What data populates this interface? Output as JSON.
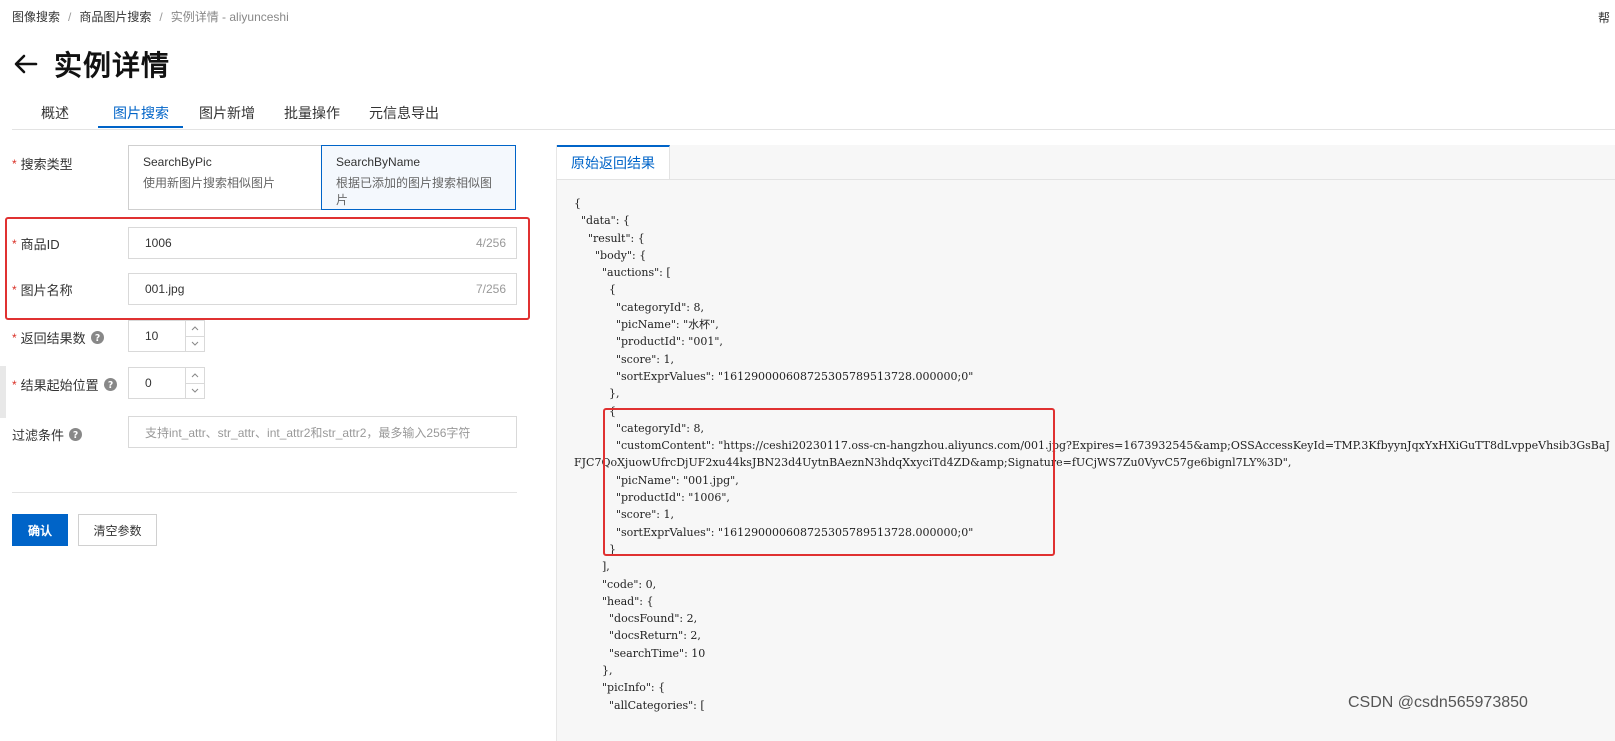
{
  "breadcrumb": {
    "item1": "图像搜索",
    "item2": "商品图片搜索",
    "item3": "实例详情 - aliyunceshi",
    "separator": "/"
  },
  "corner_text": "帮",
  "page": {
    "title": "实例详情"
  },
  "tabs": [
    {
      "label": "概述"
    },
    {
      "label": "图片搜索"
    },
    {
      "label": "图片新增"
    },
    {
      "label": "批量操作"
    },
    {
      "label": "元信息导出"
    }
  ],
  "active_tab": "图片搜索",
  "form": {
    "required_mark": "*",
    "search_type": {
      "label": "搜索类型",
      "options": [
        {
          "title": "SearchByPic",
          "desc": "使用新图片搜索相似图片"
        },
        {
          "title": "SearchByName",
          "desc": "根据已添加的图片搜索相似图片"
        }
      ],
      "selected": "SearchByName"
    },
    "product_id": {
      "label": "商品ID",
      "value": "1006",
      "count": "4/256"
    },
    "pic_name": {
      "label": "图片名称",
      "value": "001.jpg",
      "count": "7/256"
    },
    "num": {
      "label": "返回结果数",
      "value": "10"
    },
    "start": {
      "label": "结果起始位置",
      "value": "0"
    },
    "filter": {
      "label": "过滤条件",
      "placeholder": "支持int_attr、str_attr、int_attr2和str_attr2，最多输入256字符"
    },
    "confirm_label": "确认",
    "clear_label": "清空参数"
  },
  "result_panel": {
    "tab_label": "原始返回结果",
    "json_lines": [
      "{",
      "  \"data\": {",
      "    \"result\": {",
      "      \"body\": {",
      "        \"auctions\": [",
      "          {",
      "            \"categoryId\": 8,",
      "            \"picName\": \"水杯\",",
      "            \"productId\": \"001\",",
      "            \"score\": 1,",
      "            \"sortExprValues\": \"161290000608725305789513728.000000;0\"",
      "          },",
      "          {",
      "            \"categoryId\": 8,",
      "            \"customContent\": \"https://ceshi20230117.oss-cn-hangzhou.aliyuncs.com/001.jpg?Expires=1673932545&amp;OSSAccessKeyId=TMP.3KfbyynJqxYxHXiGuTT8dLvppeVhsib3GsBaJ",
      "FJC7QoXjuowUfrcDjUF2xu44ksJBN23d4UytnBAeznN3hdqXxyciTd4ZD&amp;Signature=fUCjWS7Zu0VyvC57ge6bignl7LY%3D\",",
      "            \"picName\": \"001.jpg\",",
      "            \"productId\": \"1006\",",
      "            \"score\": 1,",
      "            \"sortExprValues\": \"161290000608725305789513728.000000;0\"",
      "          }",
      "        ],",
      "        \"code\": 0,",
      "        \"head\": {",
      "          \"docsFound\": 2,",
      "          \"docsReturn\": 2,",
      "          \"searchTime\": 10",
      "        },",
      "        \"picInfo\": {",
      "          \"allCategories\": ["
    ]
  },
  "watermark": "CSDN @csdn565973850",
  "colors": {
    "primary": "#0064c8",
    "highlight_red": "#e03131",
    "required": "#d93026"
  },
  "icons": {
    "back": "arrow-left-icon",
    "help": "question-circle-icon",
    "stepper_up": "chevron-up-icon",
    "stepper_down": "chevron-down-icon"
  }
}
